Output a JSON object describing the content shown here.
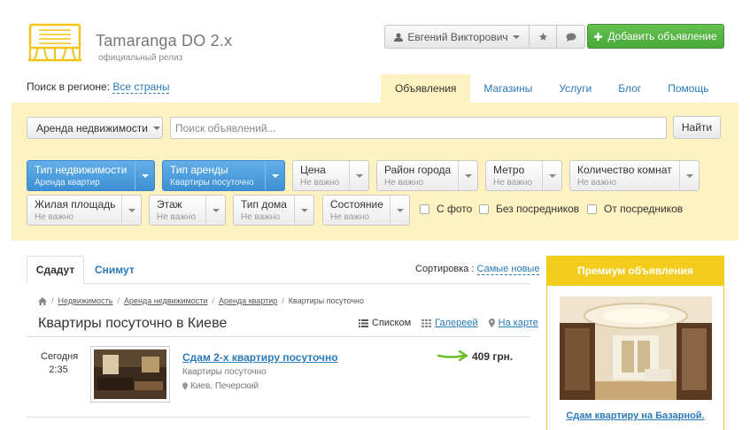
{
  "brand": {
    "title": "Tamaranga DO 2.x",
    "subtitle": "официальный релиз",
    "logo_icon": "building-icon"
  },
  "header": {
    "user_name": "Евгений Викторович",
    "add_button": "Добавить объявление",
    "accent_color": "#52b340"
  },
  "region": {
    "label": "Поиск в регионе:",
    "value": "Все страны"
  },
  "nav": {
    "items": [
      {
        "label": "Объявления",
        "active": true
      },
      {
        "label": "Магазины"
      },
      {
        "label": "Услуги"
      },
      {
        "label": "Блог"
      },
      {
        "label": "Помощь"
      }
    ]
  },
  "search": {
    "category": "Аренда недвижимости",
    "placeholder": "Поиск объявлений...",
    "button": "Найти"
  },
  "filters": [
    {
      "title": "Тип недвижимости",
      "value": "Аренда квартир",
      "active": true
    },
    {
      "title": "Тип аренды",
      "value": "Квартиры посуточно",
      "active": true
    },
    {
      "title": "Цена",
      "value": "Не важно"
    },
    {
      "title": "Район города",
      "value": "Не важно"
    },
    {
      "title": "Метро",
      "value": "Не важно"
    },
    {
      "title": "Количество комнат",
      "value": "Не важно"
    },
    {
      "title": "Жилая площадь",
      "value": "Не важно"
    },
    {
      "title": "Этаж",
      "value": "Не важно"
    },
    {
      "title": "Тип дома",
      "value": "Не важно"
    },
    {
      "title": "Состояние",
      "value": "Не важно"
    }
  ],
  "checkboxes": [
    "С фото",
    "Без посредников",
    "От посредников"
  ],
  "tabs": {
    "rent_out": "Сдадут",
    "rent_in": "Снимут"
  },
  "sort": {
    "label": "Сортировка :",
    "value": "Самые новые"
  },
  "breadcrumbs": [
    "Недвижимость",
    "Аренда недвижимости",
    "Аренда квартир",
    "Квартиры посуточно"
  ],
  "page_title": "Квартиры посуточно в Киеве",
  "views": {
    "list": "Списком",
    "gallery": "Галереей",
    "map": "На карте"
  },
  "listing": {
    "date_day": "Сегодня",
    "date_time": "2:35",
    "title": "Сдам 2-х квартиру посуточно",
    "type": "Квартиры посуточно",
    "location": "Киев, Печерский",
    "price": "409 грн."
  },
  "premium": {
    "header": "Премиум объявления",
    "title": "Сдам квартиру на Базарной."
  }
}
